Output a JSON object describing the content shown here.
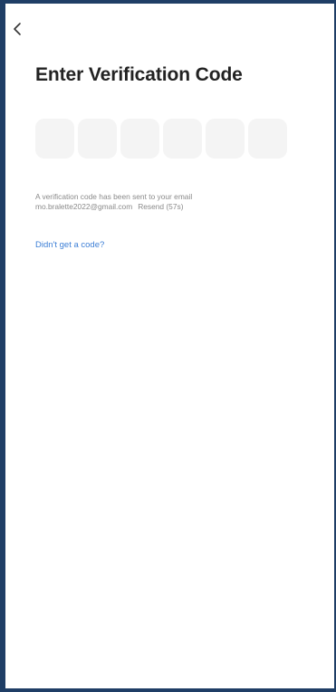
{
  "topbar": {
    "back_icon": "chevron-left-icon"
  },
  "page": {
    "title": "Enter Verification Code"
  },
  "code_input": {
    "length": 6,
    "values": [
      "",
      "",
      "",
      "",
      "",
      ""
    ]
  },
  "info": {
    "line1": "A verification code has been sent to your email",
    "email": "mo.bralette2022@gmail.com",
    "resend_label": "Resend (57s)"
  },
  "help": {
    "link_label": "Didn't get a code?"
  },
  "colors": {
    "frame": "#1f3e66",
    "title": "#222222",
    "code_box_bg": "#f4f4f4",
    "info_text": "#8a8a8a",
    "link": "#3d7fd6"
  }
}
